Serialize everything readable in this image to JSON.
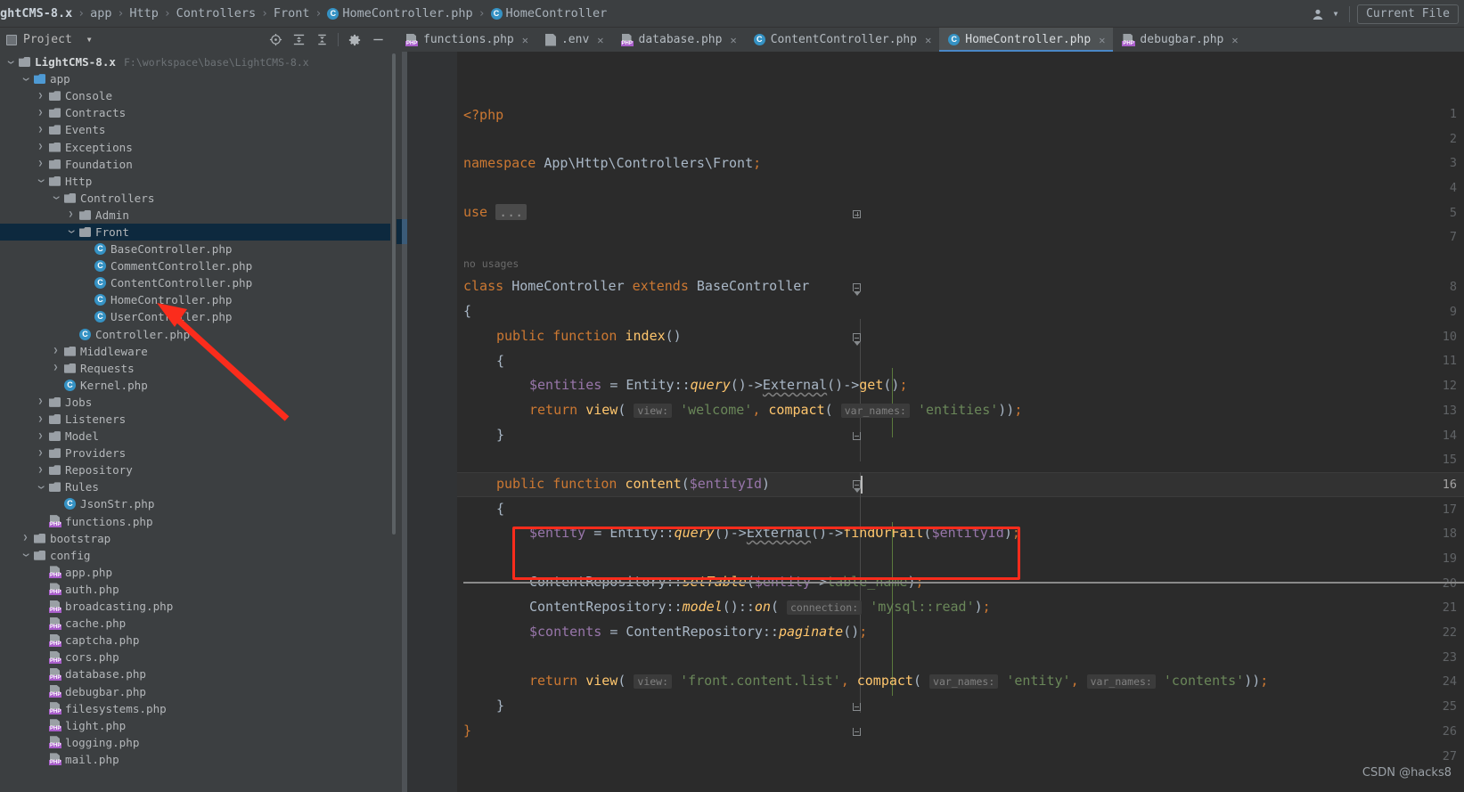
{
  "breadcrumb": {
    "root": "ghtCMS-8.x",
    "items": [
      "app",
      "Http",
      "Controllers",
      "Front"
    ],
    "file": "HomeController.php",
    "symbol": "HomeController",
    "separator": "›"
  },
  "toolbar_right": {
    "person_icon": "person-icon",
    "caret_icon": "chevron-down-icon",
    "current_file": "Current File"
  },
  "project_panel": {
    "title": "Project",
    "caret": "▾",
    "tools": [
      "locate-icon",
      "expand-all-icon",
      "collapse-all-icon",
      "settings-gear-icon",
      "hide-icon"
    ]
  },
  "tabs": [
    {
      "label": "functions.php",
      "icon": "php-file-icon",
      "active": false
    },
    {
      "label": ".env",
      "icon": "env-file-icon",
      "active": false
    },
    {
      "label": "database.php",
      "icon": "php-file-icon",
      "active": false
    },
    {
      "label": "ContentController.php",
      "icon": "php-class-icon",
      "active": false
    },
    {
      "label": "HomeController.php",
      "icon": "php-class-icon",
      "active": true
    },
    {
      "label": "debugbar.php",
      "icon": "php-file-icon",
      "active": false
    }
  ],
  "tree": [
    {
      "label": "LightCMS-8.x",
      "note": "F:\\workspace\\base\\LightCMS-8.x",
      "indent": 0,
      "icon": "folder",
      "state": "expanded",
      "bold": true
    },
    {
      "label": "app",
      "indent": 1,
      "icon": "folder-blue",
      "state": "expanded"
    },
    {
      "label": "Console",
      "indent": 2,
      "icon": "folder",
      "state": "collapsed"
    },
    {
      "label": "Contracts",
      "indent": 2,
      "icon": "folder",
      "state": "collapsed"
    },
    {
      "label": "Events",
      "indent": 2,
      "icon": "folder",
      "state": "collapsed"
    },
    {
      "label": "Exceptions",
      "indent": 2,
      "icon": "folder",
      "state": "collapsed"
    },
    {
      "label": "Foundation",
      "indent": 2,
      "icon": "folder",
      "state": "collapsed"
    },
    {
      "label": "Http",
      "indent": 2,
      "icon": "folder",
      "state": "expanded"
    },
    {
      "label": "Controllers",
      "indent": 3,
      "icon": "folder",
      "state": "expanded"
    },
    {
      "label": "Admin",
      "indent": 4,
      "icon": "folder",
      "state": "collapsed"
    },
    {
      "label": "Front",
      "indent": 4,
      "icon": "folder",
      "state": "expanded",
      "selected": true
    },
    {
      "label": "BaseController.php",
      "indent": 5,
      "icon": "class"
    },
    {
      "label": "CommentController.php",
      "indent": 5,
      "icon": "class"
    },
    {
      "label": "ContentController.php",
      "indent": 5,
      "icon": "class"
    },
    {
      "label": "HomeController.php",
      "indent": 5,
      "icon": "class"
    },
    {
      "label": "UserController.php",
      "indent": 5,
      "icon": "class"
    },
    {
      "label": "Controller.php",
      "indent": 4,
      "icon": "class"
    },
    {
      "label": "Middleware",
      "indent": 3,
      "icon": "folder",
      "state": "collapsed"
    },
    {
      "label": "Requests",
      "indent": 3,
      "icon": "folder",
      "state": "collapsed"
    },
    {
      "label": "Kernel.php",
      "indent": 3,
      "icon": "class"
    },
    {
      "label": "Jobs",
      "indent": 2,
      "icon": "folder",
      "state": "collapsed"
    },
    {
      "label": "Listeners",
      "indent": 2,
      "icon": "folder",
      "state": "collapsed"
    },
    {
      "label": "Model",
      "indent": 2,
      "icon": "folder",
      "state": "collapsed"
    },
    {
      "label": "Providers",
      "indent": 2,
      "icon": "folder",
      "state": "collapsed"
    },
    {
      "label": "Repository",
      "indent": 2,
      "icon": "folder",
      "state": "collapsed"
    },
    {
      "label": "Rules",
      "indent": 2,
      "icon": "folder",
      "state": "expanded"
    },
    {
      "label": "JsonStr.php",
      "indent": 3,
      "icon": "class"
    },
    {
      "label": "functions.php",
      "indent": 2,
      "icon": "php"
    },
    {
      "label": "bootstrap",
      "indent": 1,
      "icon": "folder",
      "state": "collapsed"
    },
    {
      "label": "config",
      "indent": 1,
      "icon": "folder",
      "state": "expanded"
    },
    {
      "label": "app.php",
      "indent": 2,
      "icon": "php"
    },
    {
      "label": "auth.php",
      "indent": 2,
      "icon": "php"
    },
    {
      "label": "broadcasting.php",
      "indent": 2,
      "icon": "php"
    },
    {
      "label": "cache.php",
      "indent": 2,
      "icon": "php"
    },
    {
      "label": "captcha.php",
      "indent": 2,
      "icon": "php"
    },
    {
      "label": "cors.php",
      "indent": 2,
      "icon": "php"
    },
    {
      "label": "database.php",
      "indent": 2,
      "icon": "php"
    },
    {
      "label": "debugbar.php",
      "indent": 2,
      "icon": "php"
    },
    {
      "label": "filesystems.php",
      "indent": 2,
      "icon": "php"
    },
    {
      "label": "light.php",
      "indent": 2,
      "icon": "php"
    },
    {
      "label": "logging.php",
      "indent": 2,
      "icon": "php"
    },
    {
      "label": "mail.php",
      "indent": 2,
      "icon": "php"
    }
  ],
  "editor": {
    "line_numbers": [
      1,
      2,
      3,
      4,
      5,
      7,
      8,
      9,
      10,
      11,
      12,
      13,
      14,
      15,
      16,
      17,
      18,
      19,
      20,
      21,
      22,
      23,
      24,
      25,
      26,
      27
    ],
    "current_line": 16,
    "inlay_hint_no_usages": "no usages",
    "code": {
      "l1": "<?php",
      "l3": "namespace App\\Http\\Controllers\\Front;",
      "l5_kw": "use",
      "l5_fold": "...",
      "l8": "class HomeController extends BaseController",
      "l9": "{",
      "l10": "public function index()",
      "l11": "{",
      "l12": "$entities = Entity::query()->External()->get();",
      "l13": "return view( view: 'welcome', compact( var_names: 'entities'));",
      "l14": "}",
      "l16": "public function content($entityId)",
      "l17": "{",
      "l18": "$entity = Entity::query()->External()->findOrFail($entityId);",
      "l20": "ContentRepository::setTable($entity->table_name);",
      "l21": "ContentRepository::model()::on( connection: 'mysql::read');",
      "l22": "$contents = ContentRepository::paginate();",
      "l24": "return view( view: 'front.content.list', compact( var_names: 'entity', var_names: 'contents'));",
      "l25": "}",
      "l26": "}"
    },
    "hints": {
      "view": "view:",
      "var_names": "var_names:",
      "connection": "connection:"
    }
  },
  "annotations": {
    "red_box_target_line": 21,
    "arrow_color": "#fb2c1c",
    "watermark": "CSDN @hacks8"
  },
  "colors": {
    "accent": "#4a88c7",
    "keyword": "#cc7832",
    "string": "#6a8759",
    "function": "#ffc66d",
    "variable": "#9876aa",
    "editor_bg": "#2b2b2b",
    "panel_bg": "#3c3f41",
    "annotation_red": "#fb2c1c"
  }
}
